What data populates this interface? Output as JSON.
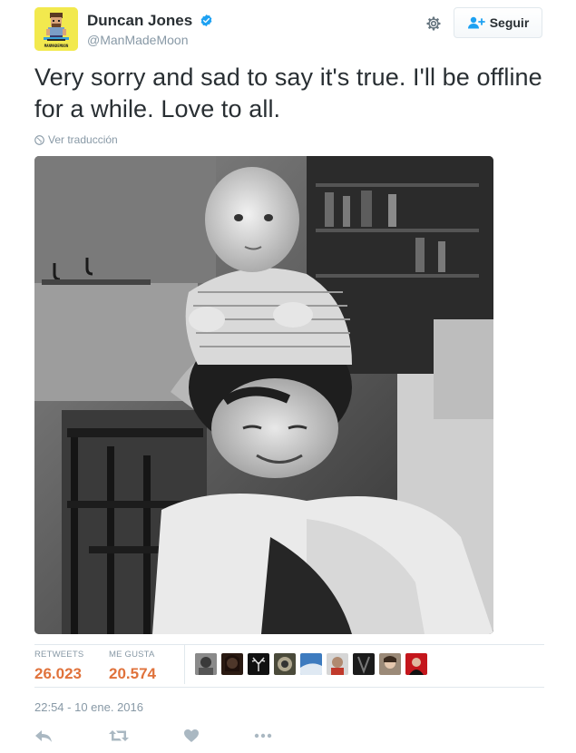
{
  "user": {
    "full_name": "Duncan Jones",
    "handle": "@ManMadeMoon",
    "avatar_caption": "MANMADEMOON",
    "verified": true
  },
  "follow_button": {
    "label": "Seguir",
    "icon": "add-user-icon"
  },
  "settings_icon": "gear-icon",
  "tweet": {
    "text": "Very sorry and sad to say it's true.  I'll be offline for a while.  Love to all.",
    "translate_label": "Ver traducción"
  },
  "photo": {
    "style": "black-and-white photograph"
  },
  "stats": {
    "retweets_label": "RETWEETS",
    "retweets_value": "26.023",
    "likes_label": "ME GUSTA",
    "likes_value": "20.574"
  },
  "likers_count": 9,
  "timestamp": "22:54 - 10 ene. 2016",
  "actions": [
    "reply-icon",
    "retweet-icon",
    "heart-icon",
    "more-icon"
  ],
  "colors": {
    "accent_stats": "#e0723b",
    "muted_text": "#8899a6",
    "verified_blue": "#1da1f2",
    "divider": "#e1e8ed"
  }
}
